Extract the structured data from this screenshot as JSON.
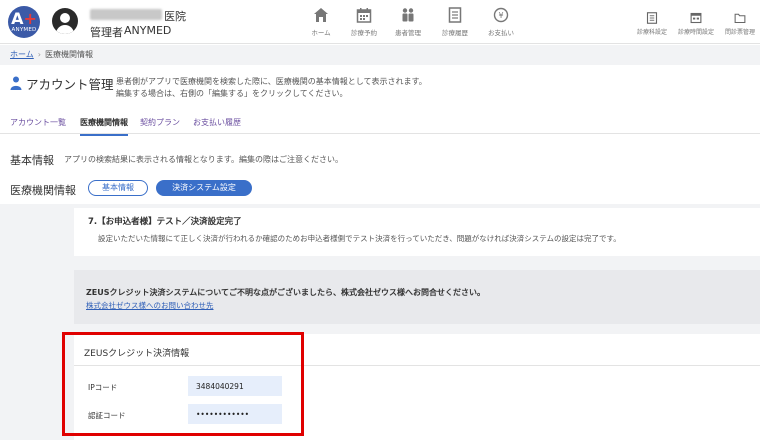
{
  "header": {
    "logo_text": "ANYMED",
    "clinic_suffix": "医院",
    "admin_role": "管理者",
    "admin_name": "ANYMED",
    "nav_main": [
      {
        "label": "ホーム",
        "icon": "home-icon"
      },
      {
        "label": "診療予約",
        "icon": "calendar-icon"
      },
      {
        "label": "患者管理",
        "icon": "patients-icon"
      },
      {
        "label": "診療履歴",
        "icon": "history-icon"
      },
      {
        "label": "お支払い",
        "icon": "payment-icon"
      }
    ],
    "nav_right": [
      {
        "label": "診療科設定",
        "icon": "department-icon"
      },
      {
        "label": "診療時間設定",
        "icon": "schedule-icon"
      },
      {
        "label": "問診票管理",
        "icon": "folder-icon"
      }
    ]
  },
  "breadcrumb": {
    "home": "ホーム",
    "current": "医療機関情報"
  },
  "page": {
    "title": "アカウント管理",
    "description_1": "患者側がアプリで医療機関を検索した際に、医療機関の基本情報として表示されます。",
    "description_2": "編集する場合は、右側の「編集する」をクリックしてください。"
  },
  "tabs": [
    {
      "label": "アカウント一覧"
    },
    {
      "label": "医療機関情報",
      "active": true
    },
    {
      "label": "契約プラン"
    },
    {
      "label": "お支払い履歴"
    }
  ],
  "basic": {
    "title": "基本情報",
    "note": "アプリの検索結果に表示される情報となります。編集の際はご注意ください。"
  },
  "med": {
    "title": "医療機関情報",
    "btn_basic": "基本情報",
    "btn_payment": "決済システム設定"
  },
  "step": {
    "title": "7.【お申込者様】テスト／決済設定完了",
    "desc": "設定いただいた情報にて正しく決済が行われるか確認のためお申込者様側でテスト決済を行っていただき、問題がなければ決済システムの設定は完了です。"
  },
  "contact": {
    "title": "ZEUSクレジット決済システムについてご不明な点がございましたら、株式会社ゼウス様へお問合せください。",
    "link": "株式会社ゼウス様へのお問い合わせ先"
  },
  "zeus": {
    "title": "ZEUSクレジット決済情報",
    "ip_label": "IPコード",
    "ip_value": "3484040291",
    "auth_label": "認証コード",
    "auth_value": "••••••••••••"
  },
  "colors": {
    "brand": "#3b5aa7",
    "accent": "#3a6fc9",
    "tab_link": "#6b4fa0",
    "highlight": "#e00000"
  }
}
